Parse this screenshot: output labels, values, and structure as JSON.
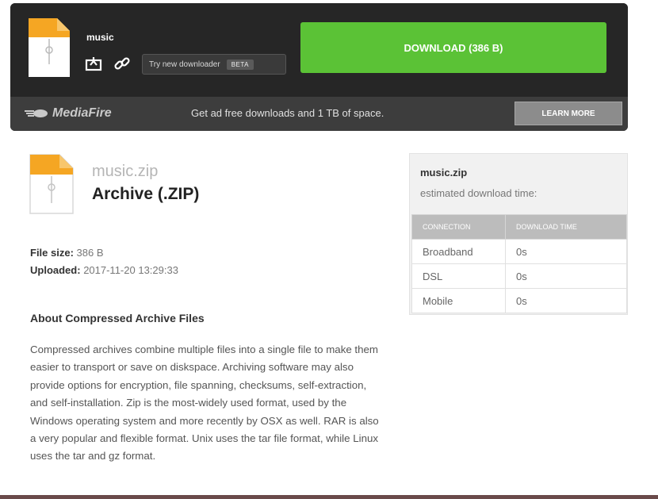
{
  "header": {
    "file_name": "music",
    "new_downloader_label": "Try new downloader",
    "beta_badge": "BETA",
    "download_button_label": "DOWNLOAD (386 B)",
    "download_color": "#5bc236"
  },
  "ad_bar": {
    "logo_text": "MediaFire",
    "message": "Get ad free downloads and 1 TB of space.",
    "learn_more_label": "LEARN MORE"
  },
  "file": {
    "name": "music.zip",
    "type": "Archive (.ZIP)",
    "size_label": "File size:",
    "size_value": "386 B",
    "uploaded_label": "Uploaded:",
    "uploaded_value": "2017-11-20 13:29:33"
  },
  "about": {
    "title": "About Compressed Archive Files",
    "text": "Compressed archives combine multiple files into a single file to make them easier to transport or save on diskspace. Archiving software may also provide options for encryption, file spanning, checksums, self-extraction, and self-installation. Zip is the most-widely used format, used by the Windows operating system and more recently by OSX as well. RAR is also a very popular and flexible format. Unix uses the tar file format, while Linux uses the tar and gz format."
  },
  "estimate": {
    "file_name": "music.zip",
    "subtitle": "estimated download time:",
    "columns": [
      "CONNECTION",
      "DOWNLOAD TIME"
    ],
    "rows": [
      {
        "connection": "Broadband",
        "time": "0s"
      },
      {
        "connection": "DSL",
        "time": "0s"
      },
      {
        "connection": "Mobile",
        "time": "0s"
      }
    ]
  },
  "icons": [
    "zip-file-icon",
    "share-icon",
    "link-icon",
    "mediafire-logo-icon"
  ]
}
